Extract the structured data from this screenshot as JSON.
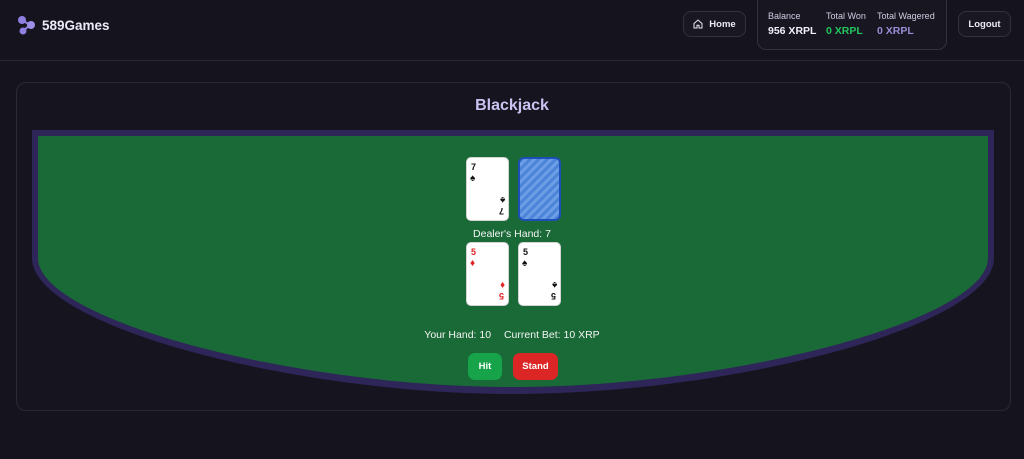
{
  "header": {
    "brand": "589Games",
    "home_label": "Home",
    "logout_label": "Logout",
    "stats": {
      "balance_label": "Balance",
      "balance_value": "956 XRPL",
      "won_label": "Total Won",
      "won_value": "0 XRPL",
      "wagered_label": "Total Wagered",
      "wagered_value": "0 XRPL"
    }
  },
  "game": {
    "title": "Blackjack",
    "dealer": {
      "label": "Dealer's Hand: 7",
      "cards": [
        {
          "rank": "7",
          "suit": "♠",
          "color": "black"
        },
        {
          "face_down": true
        }
      ]
    },
    "player": {
      "cards": [
        {
          "rank": "5",
          "suit": "♦",
          "color": "red"
        },
        {
          "rank": "5",
          "suit": "♠",
          "color": "black"
        }
      ]
    },
    "your_hand": "Your Hand: 10",
    "current_bet": "Current Bet: 10 XRP",
    "hit_label": "Hit",
    "stand_label": "Stand"
  },
  "colors": {
    "felt": "#1a6a37",
    "rail": "#2e2558",
    "hit": "#16a34a",
    "stand": "#dc2626",
    "won": "#22c55e",
    "wagered": "#9a8cd6"
  },
  "icons": {
    "logo": "molecule-logo-icon",
    "home": "home-icon",
    "card_back": "card-back-pattern"
  }
}
